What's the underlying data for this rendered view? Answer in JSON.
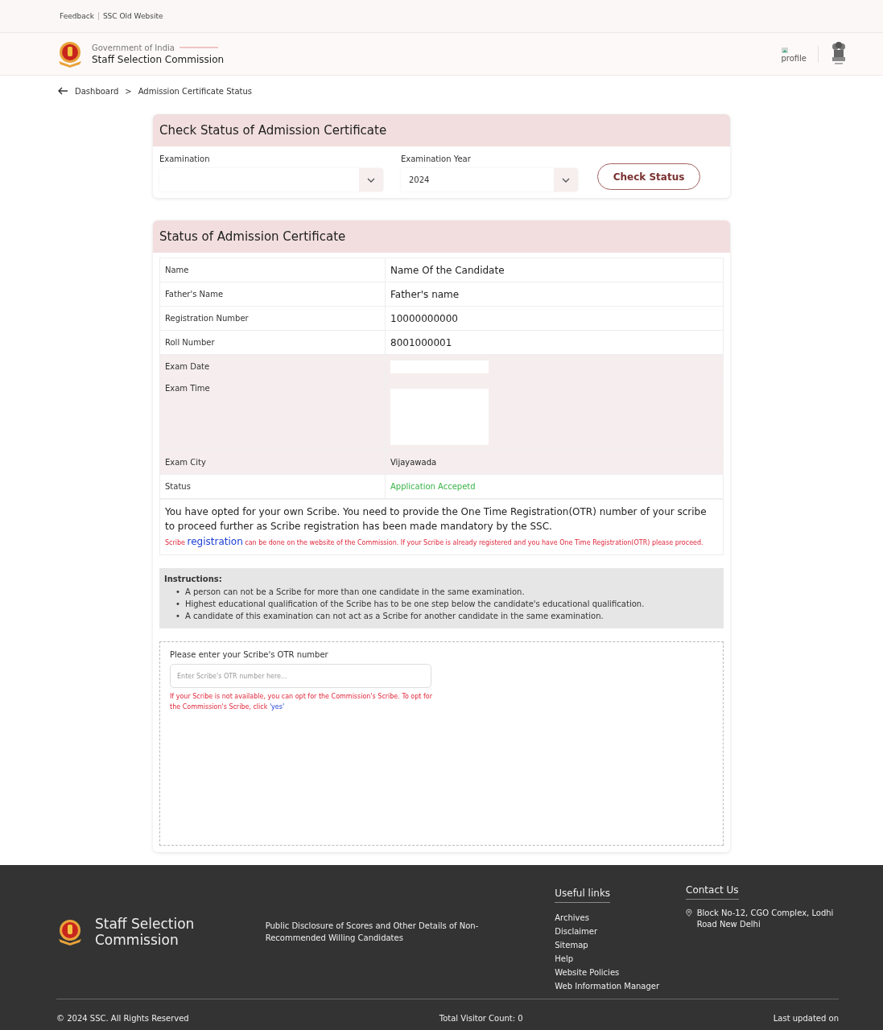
{
  "top_links": [
    "Feedback",
    "SSC Old Website"
  ],
  "header": {
    "subtitle": "Government of India",
    "title": "Staff Selection Commission",
    "profile": "profile"
  },
  "breadcrumb": {
    "items": [
      "Dashboard",
      "Admission Certificate Status"
    ],
    "separator": ">"
  },
  "check_card": {
    "title": "Check Status of Admission Certificate",
    "fields": [
      {
        "label": "Examination"
      },
      {
        "label": "Examination Year",
        "value": "2024"
      }
    ],
    "button": "Check Status"
  },
  "status_card": {
    "title": "Status of Admission Certificate",
    "rows": [
      {
        "label": "Name",
        "kind": "text",
        "value": "Name Of the Candidate",
        "shaded": false
      },
      {
        "label": "Father's Name",
        "kind": "text",
        "value": "Father's name",
        "shaded": false
      },
      {
        "label": "Registration Number",
        "kind": "text",
        "value": "10000000000",
        "shaded": false
      },
      {
        "label": "Roll Number",
        "kind": "text",
        "value": "8001000001",
        "shaded": false
      },
      {
        "label": "Exam Date",
        "kind": "blank",
        "shaded": true
      },
      {
        "label": "Exam Time",
        "kind": "blank-tall",
        "shaded": true
      },
      {
        "label": "Exam City",
        "kind": "small",
        "value": "Vijayawada",
        "shaded": true
      },
      {
        "label": "Status",
        "kind": "status",
        "value": "Application Accepetd",
        "shaded": false
      }
    ],
    "notice": "You have opted for your own Scribe. You need to provide the One Time Registration(OTR) number of your scribe to proceed further as Scribe registration has been made mandatory by the SSC.",
    "note": {
      "before": "Scribe",
      "link": "registration",
      "after": "can be done on the website of the Commission. If your Scribe is already registered and you have One Time Registration(OTR) please proceed."
    },
    "instructions": {
      "title": "Instructions:",
      "bullet": "•",
      "items": [
        "A person can not be a Scribe for more than one candidate in the same examination.",
        "Highest educational qualification of the Scribe has to be one step below the candidate's educational qualification.",
        "A candidate of this examination can not act as a Scribe for another candidate in the same examination."
      ]
    },
    "otr": {
      "label": "Please enter your Scribe's OTR number",
      "placeholder": "Enter Scribe's OTR number here...",
      "hint": "If your Scribe is not available, you can opt for the Commission's Scribe. To opt for the Commission's Scribe, click",
      "hint_link": "'yes'"
    }
  },
  "footer": {
    "brand": "Staff Selection Commission",
    "disclosure": "Public Disclosure of Scores and Other Details of Non-Recommended Willing Candidates",
    "links_title": "Useful links",
    "links": [
      "Archives",
      "Disclaimer",
      "Sitemap",
      "Help",
      "Website Policies",
      "Web Information Manager"
    ],
    "contact_title": "Contact Us",
    "address": "Block No-12, CGO Complex, Lodhi Road New Delhi",
    "copyright": "© 2024 SSC. All Rights Reserved",
    "visitors": "Total Visitor Count: 0",
    "updated": "Last updated on"
  }
}
